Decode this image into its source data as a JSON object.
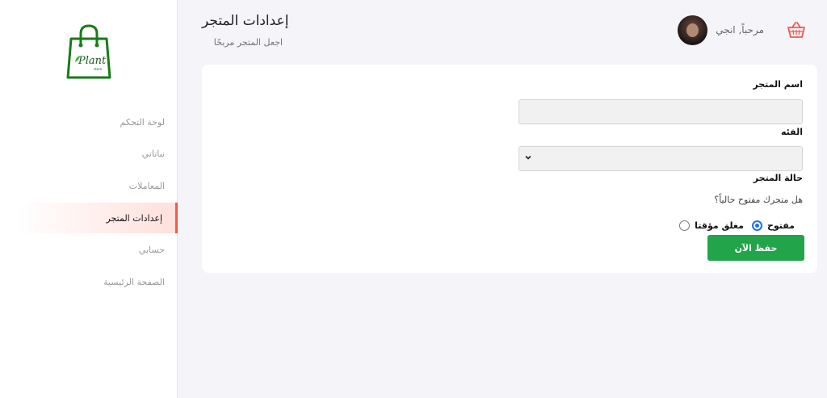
{
  "header": {
    "title": "إعدادات المتجر",
    "subtitle": "اجعل المتجر مربحًا",
    "greeting": "مرحباً, انجي"
  },
  "logo": {
    "text": "Plant",
    "subtext": "store"
  },
  "sidebar": {
    "items": [
      {
        "label": "لوحة التحكم",
        "active": false
      },
      {
        "label": "نباتاتي",
        "active": false
      },
      {
        "label": "المعاملات",
        "active": false
      },
      {
        "label": "إعدادات المتجر",
        "active": true
      },
      {
        "label": "حسابي",
        "active": false
      },
      {
        "label": "الصفحة الرئيسية",
        "active": false
      }
    ]
  },
  "form": {
    "store_name_label": "اسم المتجر",
    "store_name_value": "",
    "category_label": "الفئه",
    "category_value": "",
    "status_label": "حالة المتجر",
    "status_question": "هل متجرك مفتوح حالياً؟",
    "status_open": "مفتوح",
    "status_closed": "مغلق مؤقتا",
    "status_selected": "مفتوح",
    "save_label": "حفظ الآن"
  },
  "colors": {
    "accent": "#22a44a",
    "active_bar": "#f05a4a",
    "logo_green": "#1a7a1a",
    "cart": "#f05a4a"
  },
  "icons": {
    "cart": "shopping-basket-icon",
    "chevron": "chevron-down-icon",
    "logo": "shopping-bag-icon"
  }
}
